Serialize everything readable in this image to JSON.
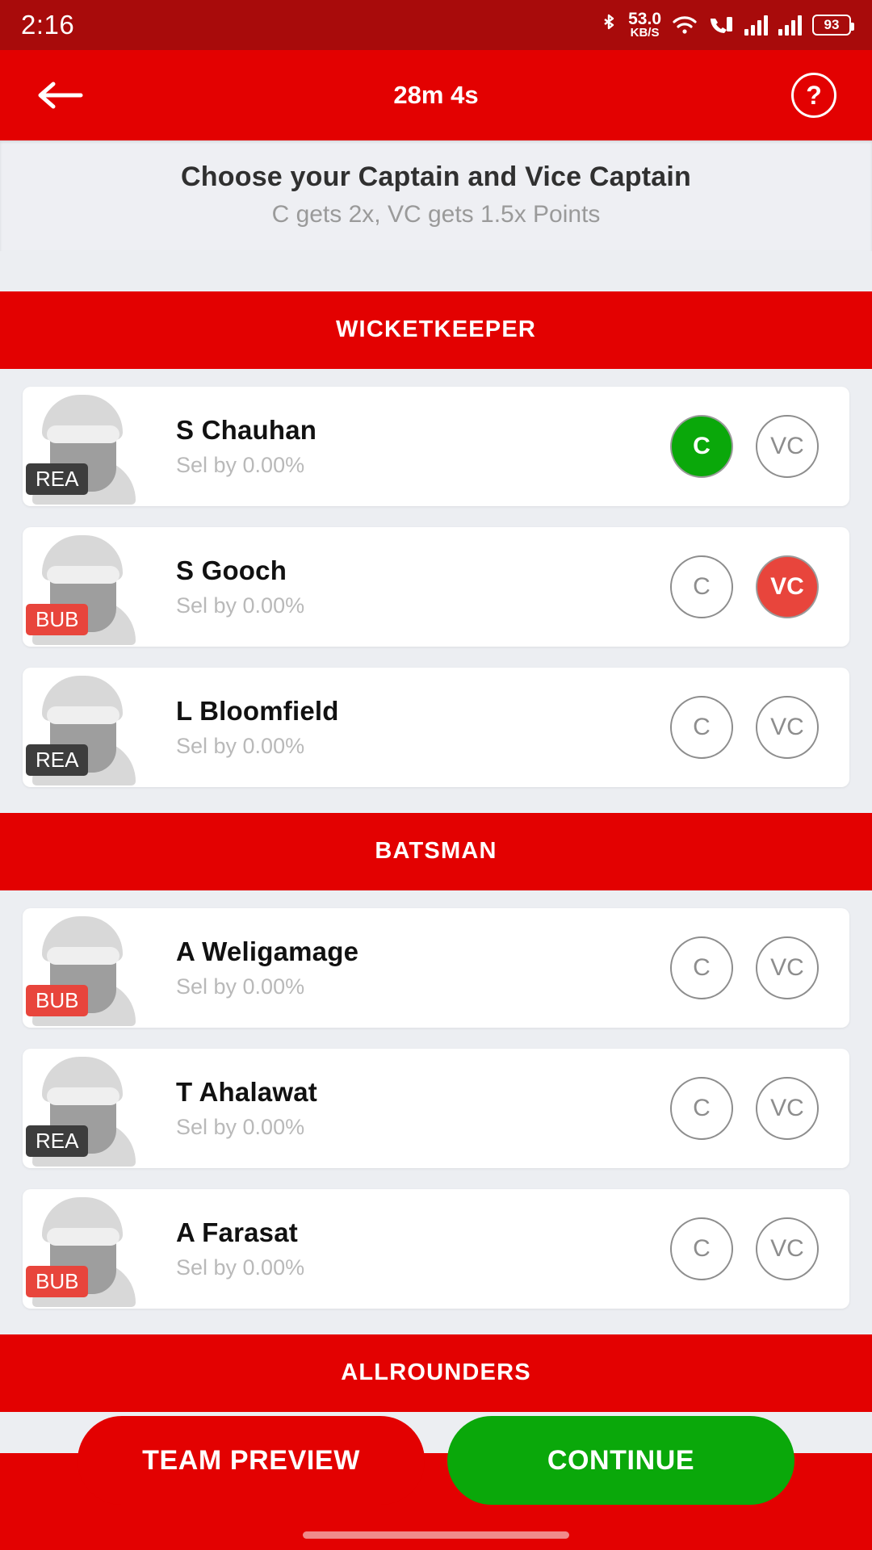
{
  "status_bar": {
    "time": "2:16",
    "net_speed_value": "53.0",
    "net_speed_unit": "KB/S",
    "battery": "93",
    "icons": [
      "bluetooth-icon",
      "wifi-icon",
      "call-wifi-icon",
      "signal-bars-icon",
      "signal-bars-icon",
      "battery-icon"
    ]
  },
  "app_bar": {
    "back_icon": "back-arrow-icon",
    "timer": "28m 4s",
    "help_label": "?"
  },
  "instruction": {
    "title": "Choose your Captain and Vice Captain",
    "subtitle": "C gets 2x, VC gets 1.5x Points"
  },
  "colors": {
    "brand_red": "#e30101",
    "status_bar_red": "#a80b0b",
    "captain_green": "#0aa80a",
    "vice_captain_red": "#e8453c",
    "badge_dark": "#3d3d3d",
    "badge_red": "#e8453c",
    "page_bg": "#eceef2"
  },
  "pick_labels": {
    "captain": "C",
    "vice_captain": "VC"
  },
  "sections": [
    {
      "title": "WICKETKEEPER",
      "players": [
        {
          "name": "S Chauhan",
          "selected_by": "Sel by 0.00%",
          "team": "REA",
          "team_color": "#3d3d3d",
          "pick": "C"
        },
        {
          "name": "S Gooch",
          "selected_by": "Sel by 0.00%",
          "team": "BUB",
          "team_color": "#e8453c",
          "pick": "VC"
        },
        {
          "name": "L Bloomfield",
          "selected_by": "Sel by 0.00%",
          "team": "REA",
          "team_color": "#3d3d3d",
          "pick": "none"
        }
      ]
    },
    {
      "title": "BATSMAN",
      "players": [
        {
          "name": "A Weligamage",
          "selected_by": "Sel by 0.00%",
          "team": "BUB",
          "team_color": "#e8453c",
          "pick": "none"
        },
        {
          "name": "T Ahalawat",
          "selected_by": "Sel by 0.00%",
          "team": "REA",
          "team_color": "#3d3d3d",
          "pick": "none"
        },
        {
          "name": "A Farasat",
          "selected_by": "Sel by 0.00%",
          "team": "BUB",
          "team_color": "#e8453c",
          "pick": "none"
        }
      ]
    },
    {
      "title": "ALLROUNDERS",
      "players": []
    }
  ],
  "footer": {
    "team_preview_label": "TEAM PREVIEW",
    "continue_label": "CONTINUE"
  }
}
